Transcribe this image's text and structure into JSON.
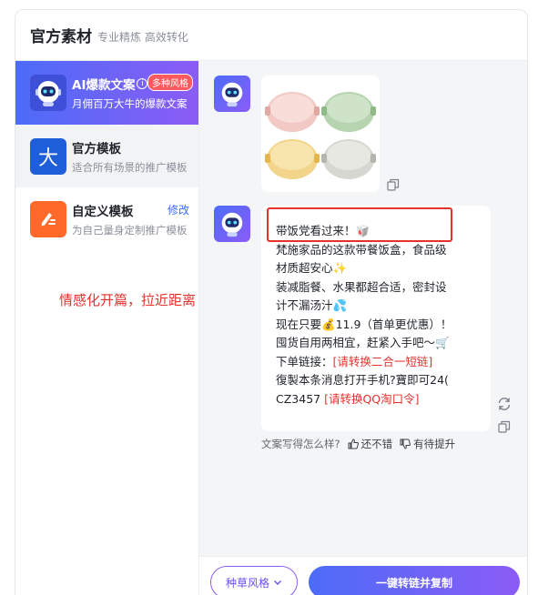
{
  "header": {
    "title": "官方素材",
    "subtitle": "专业精炼 高效转化"
  },
  "sidebar": {
    "items": [
      {
        "title": "AI爆款文案",
        "desc": "月佣百万大牛的爆款文案",
        "badge": "多种风格",
        "info": "i",
        "icon": "robot-icon"
      },
      {
        "title": "官方模板",
        "desc": "适合所有场景的推广模板",
        "icon_text": "大",
        "icon": "da-character-icon"
      },
      {
        "title": "自定义模板",
        "desc": "为自己量身定制推广模板",
        "action": "修改",
        "icon": "pen-edit-icon"
      }
    ],
    "annotation": "情感化开篇，拉近距离"
  },
  "chat": {
    "image_alt": "food-containers-image",
    "message_lines": [
      "带饭党看过来！🥡",
      "梵施家品的这款带餐饭盒，食品级",
      "材质超安心✨",
      "装减脂餐、水果都超合适，密封设",
      "计不漏汤汁💦",
      "现在只要💰11.9（首单更优惠）！",
      "囤货自用两相宜，赶紧入手吧～🛒",
      "下单链接："
    ],
    "link_placeholder": "[请转换二合一短链]",
    "code_line_1": "復製本条消息打开手机?寶即可24(",
    "code_line_2": "CZ3457",
    "code_placeholder": "[请转换QQ淘口令]",
    "feedback": {
      "question": "文案写得怎么样?",
      "good": "还不错",
      "bad": "有待提升"
    }
  },
  "bottom": {
    "style_select": "种草风格",
    "primary_button": "一键转链并复制"
  },
  "colors": {
    "accent_start": "#4c6cf7",
    "accent_end": "#8b5cf6",
    "annotation_red": "#e5322d",
    "link_blue": "#3b6cf6"
  }
}
